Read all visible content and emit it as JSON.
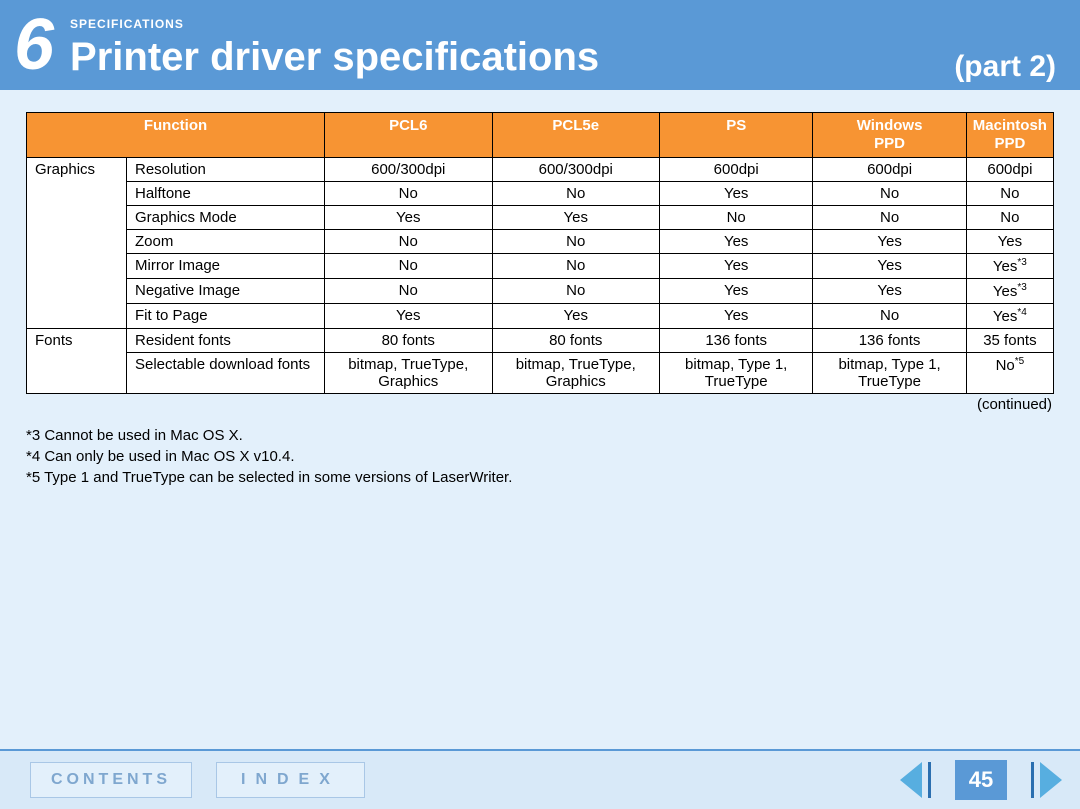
{
  "header": {
    "chapter_number": "6",
    "section_label": "SPECIFICATIONS",
    "title": "Printer driver specifications",
    "part": "(part 2)"
  },
  "table": {
    "headers": {
      "function": "Function",
      "pcl6": "PCL6",
      "pcl5e": "PCL5e",
      "ps": "PS",
      "win_ppd_top": "Windows",
      "win_ppd_sub": "PPD",
      "mac_ppd_top": "Macintosh",
      "mac_ppd_sub": "PPD"
    },
    "groups": [
      {
        "name": "Graphics",
        "rows": [
          {
            "sub": "Resolution",
            "pcl6": "600/300dpi",
            "pcl5e": "600/300dpi",
            "ps": "600dpi",
            "win": "600dpi",
            "mac": "600dpi",
            "mac_sup": ""
          },
          {
            "sub": "Halftone",
            "pcl6": "No",
            "pcl5e": "No",
            "ps": "Yes",
            "win": "No",
            "mac": "No",
            "mac_sup": ""
          },
          {
            "sub": "Graphics Mode",
            "pcl6": "Yes",
            "pcl5e": "Yes",
            "ps": "No",
            "win": "No",
            "mac": "No",
            "mac_sup": ""
          },
          {
            "sub": "Zoom",
            "pcl6": "No",
            "pcl5e": "No",
            "ps": "Yes",
            "win": "Yes",
            "mac": "Yes",
            "mac_sup": ""
          },
          {
            "sub": "Mirror Image",
            "pcl6": "No",
            "pcl5e": "No",
            "ps": "Yes",
            "win": "Yes",
            "mac": "Yes",
            "mac_sup": "*3"
          },
          {
            "sub": "Negative Image",
            "pcl6": "No",
            "pcl5e": "No",
            "ps": "Yes",
            "win": "Yes",
            "mac": "Yes",
            "mac_sup": "*3"
          },
          {
            "sub": "Fit to Page",
            "pcl6": "Yes",
            "pcl5e": "Yes",
            "ps": "Yes",
            "win": "No",
            "mac": "Yes",
            "mac_sup": "*4"
          }
        ]
      },
      {
        "name": "Fonts",
        "rows": [
          {
            "sub": "Resident fonts",
            "pcl6": "80 fonts",
            "pcl5e": "80 fonts",
            "ps": "136 fonts",
            "win": "136 fonts",
            "mac": "35 fonts",
            "mac_sup": ""
          },
          {
            "sub": "Selectable download fonts",
            "pcl6": "bitmap, TrueType, Graphics",
            "pcl5e": "bitmap, TrueType, Graphics",
            "ps": "bitmap, Type 1, TrueType",
            "win": "bitmap, Type 1, TrueType",
            "mac": "No",
            "mac_sup": "*5"
          }
        ]
      }
    ],
    "continued": "(continued)"
  },
  "footnotes": [
    "*3 Cannot be used in Mac OS X.",
    "*4 Can only be used in Mac OS X v10.4.",
    "*5 Type 1 and TrueType can be selected in some versions of LaserWriter."
  ],
  "footer": {
    "contents": "CONTENTS",
    "index": "INDEX",
    "page": "45"
  }
}
